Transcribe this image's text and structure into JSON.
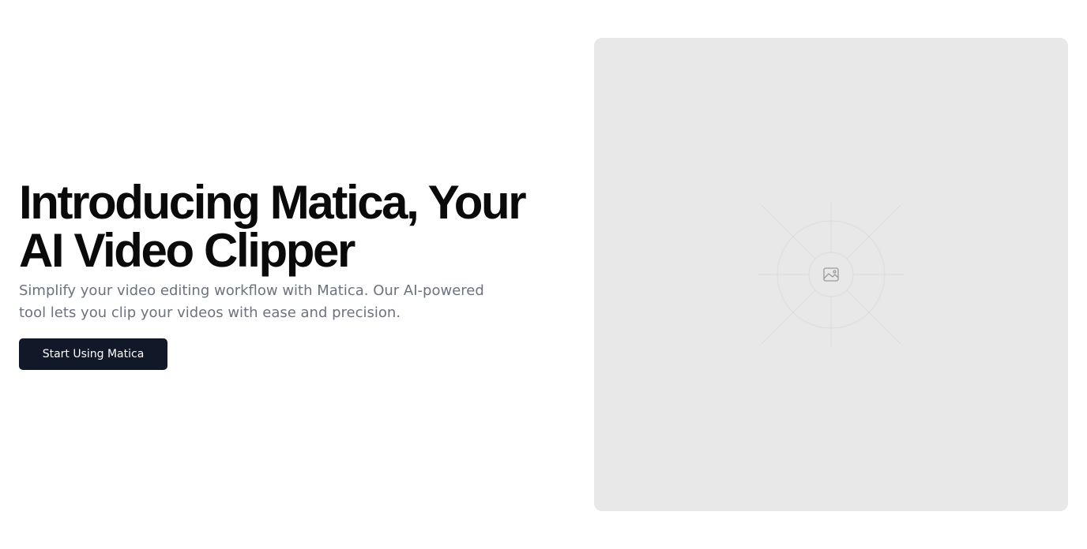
{
  "hero": {
    "title": "Introducing Matica, Your AI Video Clipper",
    "subtitle": "Simplify your video editing workflow with Matica. Our AI-powered tool lets you clip your videos with ease and precision.",
    "cta_label": "Start Using Matica"
  },
  "media": {
    "icon": "image-icon",
    "background_color": "#e8e8e8"
  },
  "colors": {
    "button_bg": "#111827",
    "title": "#0a0a0a",
    "subtitle": "#6b7280"
  }
}
